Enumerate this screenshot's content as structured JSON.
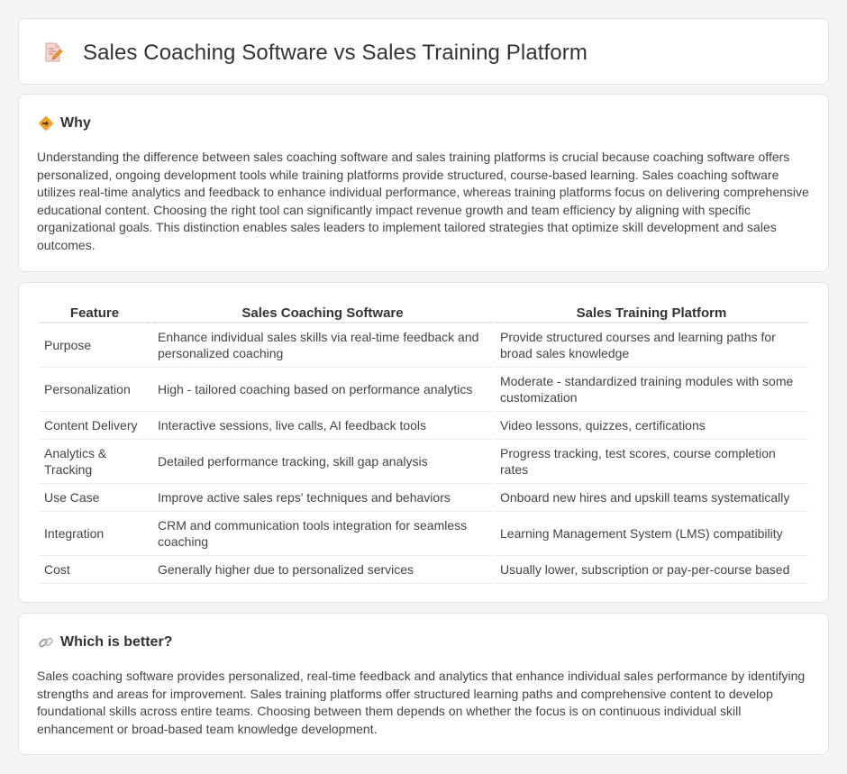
{
  "header": {
    "title": "Sales Coaching Software vs Sales Training Platform",
    "icon": "document-pencil-icon"
  },
  "why": {
    "heading": "Why",
    "icon": "diamond-signpost-icon",
    "text": "Understanding the difference between sales coaching software and sales training platforms is crucial because coaching software offers personalized, ongoing development tools while training platforms provide structured, course-based learning. Sales coaching software utilizes real-time analytics and feedback to enhance individual performance, whereas training platforms focus on delivering comprehensive educational content. Choosing the right tool can significantly impact revenue growth and team efficiency by aligning with specific organizational goals. This distinction enables sales leaders to implement tailored strategies that optimize skill development and sales outcomes."
  },
  "table": {
    "headers": [
      "Feature",
      "Sales Coaching Software",
      "Sales Training Platform"
    ],
    "rows": [
      [
        "Purpose",
        "Enhance individual sales skills via real-time feedback and personalized coaching",
        "Provide structured courses and learning paths for broad sales knowledge"
      ],
      [
        "Personalization",
        "High - tailored coaching based on performance analytics",
        "Moderate - standardized training modules with some customization"
      ],
      [
        "Content Delivery",
        "Interactive sessions, live calls, AI feedback tools",
        "Video lessons, quizzes, certifications"
      ],
      [
        "Analytics & Tracking",
        "Detailed performance tracking, skill gap analysis",
        "Progress tracking, test scores, course completion rates"
      ],
      [
        "Use Case",
        "Improve active sales reps' techniques and behaviors",
        "Onboard new hires and upskill teams systematically"
      ],
      [
        "Integration",
        "CRM and communication tools integration for seamless coaching",
        "Learning Management System (LMS) compatibility"
      ],
      [
        "Cost",
        "Generally higher due to personalized services",
        "Usually lower, subscription or pay-per-course based"
      ]
    ]
  },
  "better": {
    "heading": "Which is better?",
    "icon": "link-icon",
    "text": "Sales coaching software provides personalized, real-time feedback and analytics that enhance individual sales performance by identifying strengths and areas for improvement. Sales training platforms offer structured learning paths and comprehensive content to develop foundational skills across entire teams. Choosing between them depends on whether the focus is on continuous individual skill enhancement or broad-based team knowledge development."
  },
  "colors": {
    "page_bg": "#f5f5f7",
    "card_bg": "#ffffff",
    "accent_orange": "#f0a030",
    "icon_red": "#e8604a"
  }
}
